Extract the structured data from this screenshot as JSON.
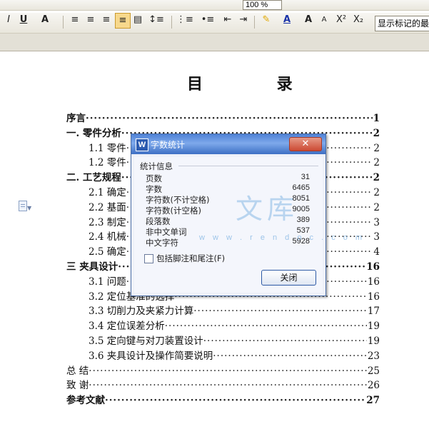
{
  "toolbar": {
    "zoom_value": "100 %",
    "style_box_value": "显示标记的最",
    "format_buttons": [
      "I",
      "U",
      "A",
      "A",
      "A",
      "X²",
      "X₂"
    ]
  },
  "document": {
    "title": "目 录",
    "toc": [
      {
        "text": "序言",
        "page": "1",
        "bold": true,
        "indent": 0
      },
      {
        "text": "一.  零件分析",
        "page": "2",
        "bold": true,
        "indent": 0
      },
      {
        "text": "1.1 零件",
        "page": "2",
        "bold": false,
        "indent": 1
      },
      {
        "text": "1.2 零件",
        "page": "2",
        "bold": false,
        "indent": 1
      },
      {
        "text": "二.  工艺规程",
        "page": "2",
        "bold": true,
        "indent": 0
      },
      {
        "text": "2.1 确定",
        "page": "2",
        "bold": false,
        "indent": 1
      },
      {
        "text": "2.2 基面",
        "page": "2",
        "bold": false,
        "indent": 1
      },
      {
        "text": "2.3 制定",
        "page": "3",
        "bold": false,
        "indent": 1
      },
      {
        "text": "2.4 机械",
        "page": "3",
        "bold": false,
        "indent": 1
      },
      {
        "text": "2.5 确定",
        "page": "4",
        "bold": false,
        "indent": 1
      },
      {
        "text": "三   夹具设计",
        "page": "16",
        "bold": true,
        "indent": 0
      },
      {
        "text": "3.1 问题",
        "page": "16",
        "bold": false,
        "indent": 1
      },
      {
        "text": "3.2 定位基准的选择",
        "page": "16",
        "bold": false,
        "indent": 1
      },
      {
        "text": "3.3 切削力及夹紧力计算",
        "page": "17",
        "bold": false,
        "indent": 1
      },
      {
        "text": "3.4 定位误差分析",
        "page": "19",
        "bold": false,
        "indent": 1
      },
      {
        "text": "3.5 定向键与对刀装置设计",
        "page": "19",
        "bold": false,
        "indent": 1
      },
      {
        "text": "3.6 夹具设计及操作简要说明",
        "page": "23",
        "bold": false,
        "indent": 1
      },
      {
        "text": "总  结",
        "page": "25",
        "bold": false,
        "indent": 0
      },
      {
        "text": "致  谢",
        "page": "26",
        "bold": false,
        "indent": 0
      },
      {
        "text": "参考文献",
        "page": "27",
        "bold": true,
        "indent": 0
      }
    ]
  },
  "dialog": {
    "title": "字数统计",
    "icon_letter": "W",
    "close_x": "✕",
    "group_label": "统计信息",
    "stats": [
      {
        "label": "页数",
        "value": "31"
      },
      {
        "label": "字数",
        "value": "6465"
      },
      {
        "label": "字符数(不计空格)",
        "value": "8051"
      },
      {
        "label": "字符数(计空格)",
        "value": "9005"
      },
      {
        "label": "段落数",
        "value": "389"
      },
      {
        "label": "非中文单词",
        "value": "537"
      },
      {
        "label": "中文字符",
        "value": "5928"
      }
    ],
    "checkbox_label": "包括脚注和尾注(F)",
    "checkbox_checked": false,
    "close_button": "关闭"
  },
  "watermark": {
    "text": "文库",
    "url": "w w w . r e n d o c . c o m"
  }
}
